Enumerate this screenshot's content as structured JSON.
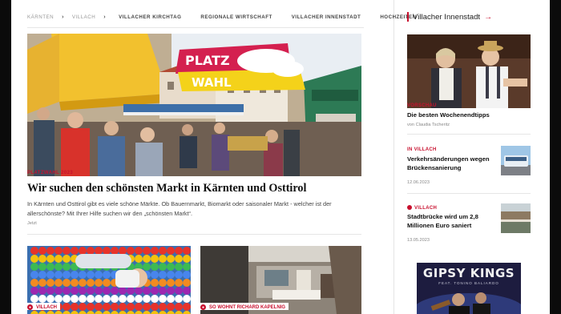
{
  "breadcrumb": {
    "items": [
      "KÄRNTEN",
      "VILLACH"
    ]
  },
  "nav": {
    "topics": [
      "VILLACHER KIRCHTAG",
      "REGIONALE WIRTSCHAFT",
      "VILLACHER INNENSTADT",
      "HOCHZEITEN"
    ]
  },
  "hero": {
    "sign_line1": "PLATZ",
    "sign_line2": "WAHL",
    "kicker": "PLATZWAHL 2023",
    "headline": "Wir suchen den schönsten Markt in Kärnten und Osttirol",
    "teaser_line1": "In Kärnten und Osttirol gibt es viele schöne Märkte. Ob Bauernmarkt, Biomarkt oder saisonaler Markt - welcher ist der",
    "teaser_line2": "allerschönste? Mit Ihrer Hilfe suchen wir den „schönsten Markt“.",
    "time": "Jetzt"
  },
  "bottom_articles": [
    {
      "category": "VILLACH"
    },
    {
      "category": "SO WOHNT RICHARD KAPELNIG"
    }
  ],
  "sidebar": {
    "title": "Villacher Innenstadt",
    "arrow_icon": "arrow-right-icon",
    "articles": [
      {
        "kicker": "VORSCHAU",
        "headline": "Die besten Wochenendtipps",
        "byline": "von Claudia Tscheritz"
      },
      {
        "kicker": "IN VILLACH",
        "headline_line1": "Verkehrsänderungen wegen",
        "headline_line2": "Brückensanierung",
        "date": "12.06.2023"
      },
      {
        "kicker": "VILLACH",
        "headline_line1": "Stadtbrücke wird um 2,8",
        "headline_line2": "Millionen Euro saniert",
        "date": "13.05.2023"
      }
    ],
    "ad": {
      "title": "GIPSY KINGS",
      "subtitle": "FEAT. TONINO BALIARDO"
    }
  },
  "colors": {
    "accent": "#c8102e",
    "text": "#111111",
    "muted": "#888888"
  }
}
